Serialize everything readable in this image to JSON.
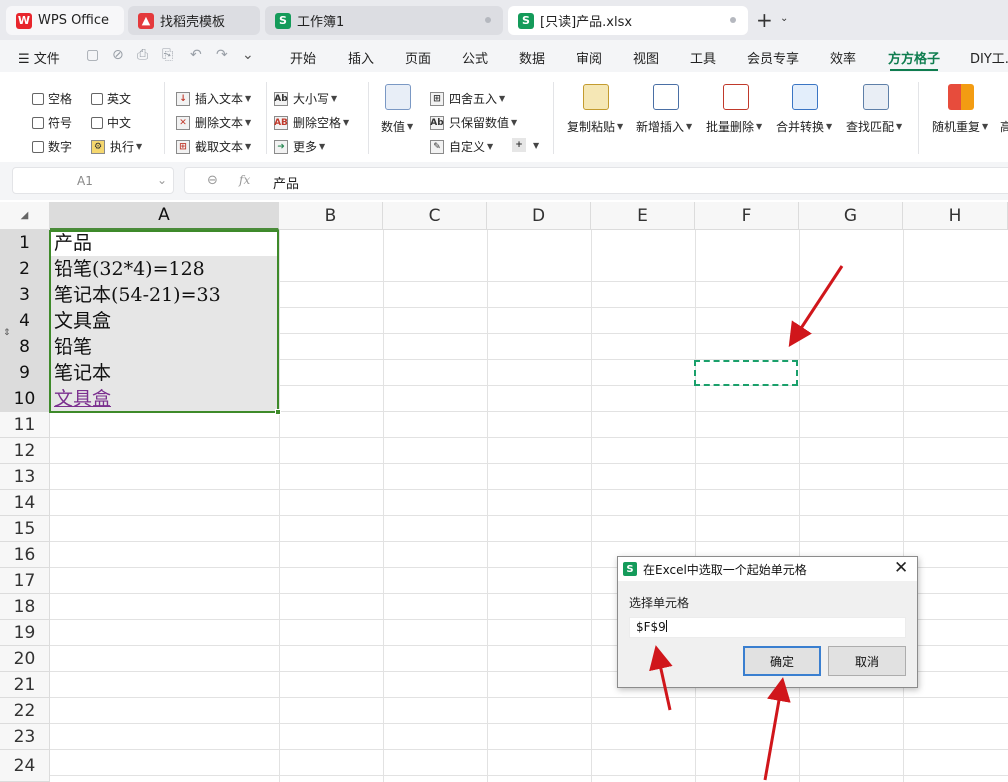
{
  "tabs": [
    {
      "label": "WPS Office",
      "icon": "wps-logo-icon"
    },
    {
      "label": "找稻壳模板",
      "icon": "docer-icon"
    },
    {
      "label": "工作簿1",
      "icon": "spreadsheet-icon"
    },
    {
      "label": "[只读]产品.xlsx",
      "icon": "spreadsheet-icon",
      "active": true
    }
  ],
  "menu": {
    "file": "文件",
    "items": [
      "开始",
      "插入",
      "页面",
      "公式",
      "数据",
      "审阅",
      "视图",
      "工具",
      "会员专享",
      "效率",
      "方方格子",
      "DIY工..."
    ],
    "active": "方方格子"
  },
  "ribbon": {
    "checkboxes": [
      "空格",
      "英文",
      "符号",
      "中文",
      "数字"
    ],
    "execute": "执行",
    "insert_text": "插入文本",
    "delete_text": "删除文本",
    "extract_text": "截取文本",
    "case": "大小写",
    "delete_space": "删除空格",
    "more": "更多",
    "numeric": "数值",
    "round": "四舍五入",
    "keep_numeric": "只保留数值",
    "custom": "自定义",
    "copy_paste": "复制粘贴",
    "add_insert": "新增插入",
    "batch_delete": "批量删除",
    "merge_convert": "合并转换",
    "find_match": "查找匹配",
    "random_repeat": "随机重复",
    "high": "高"
  },
  "formula_bar": {
    "name_box": "A1",
    "fx": "fx",
    "content": "产品"
  },
  "columns": [
    "A",
    "B",
    "C",
    "D",
    "E",
    "F",
    "G",
    "H"
  ],
  "rows": [
    "1",
    "2",
    "3",
    "4",
    "8",
    "9",
    "10",
    "11",
    "12",
    "13",
    "14",
    "15",
    "16",
    "17",
    "18",
    "19",
    "20",
    "21",
    "22",
    "23",
    "24"
  ],
  "cells_a": [
    "产品",
    "铅笔(32*4)=128",
    "笔记本(54-21)=33",
    "文具盒",
    "铅笔",
    "笔记本",
    "文具盒"
  ],
  "dialog": {
    "title": "在Excel中选取一个起始单元格",
    "label": "选择单元格",
    "value": "$F$9",
    "ok": "确定",
    "cancel": "取消",
    "close": "✕"
  },
  "colors": {
    "accent": "#0f7d4f",
    "selection_border": "#3e8a2a",
    "marquee": "#1aa06b",
    "arrow": "#d0161b",
    "hyperlink": "#7b2f8f"
  }
}
